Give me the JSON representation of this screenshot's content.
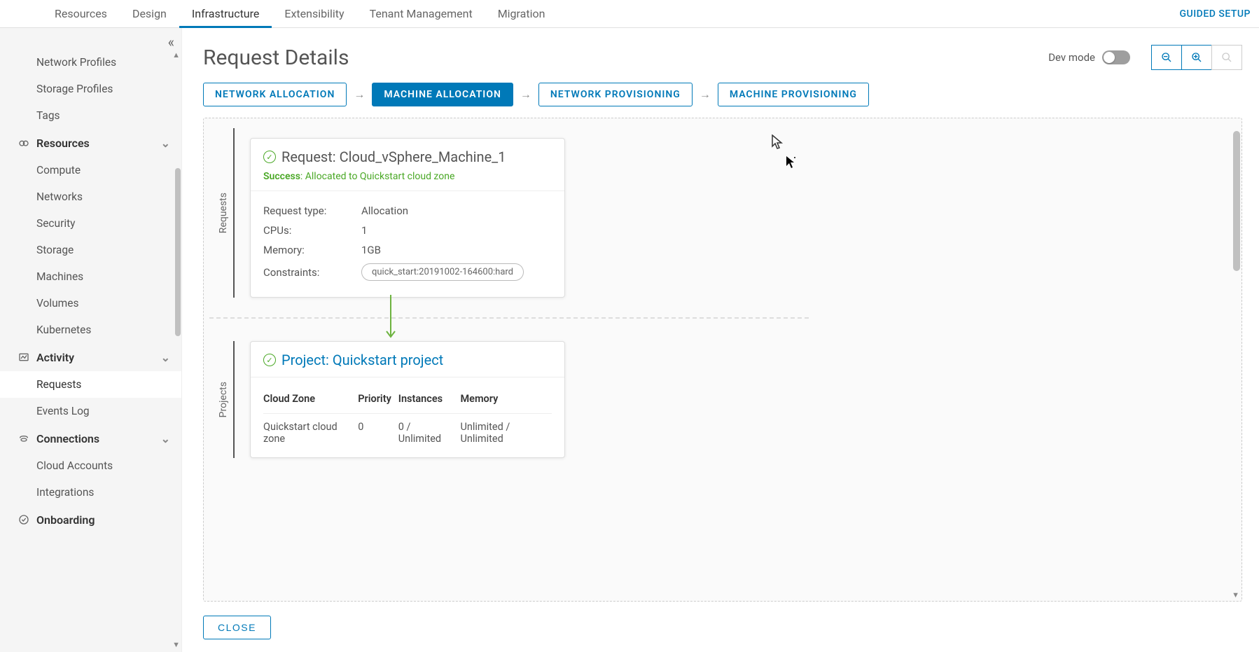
{
  "topNav": {
    "tabs": [
      "Resources",
      "Design",
      "Infrastructure",
      "Extensibility",
      "Tenant Management",
      "Migration"
    ],
    "active": "Infrastructure",
    "guided": "GUIDED SETUP"
  },
  "sidebar": {
    "itemsTop": [
      "Network Profiles",
      "Storage Profiles",
      "Tags"
    ],
    "groups": [
      {
        "label": "Resources",
        "icon": "resources-icon",
        "items": [
          "Compute",
          "Networks",
          "Security",
          "Storage",
          "Machines",
          "Volumes",
          "Kubernetes"
        ]
      },
      {
        "label": "Activity",
        "icon": "activity-icon",
        "items": [
          "Requests",
          "Events Log"
        ],
        "active": "Requests"
      },
      {
        "label": "Connections",
        "icon": "connections-icon",
        "items": [
          "Cloud Accounts",
          "Integrations"
        ]
      },
      {
        "label": "Onboarding",
        "icon": "onboarding-icon",
        "items": []
      }
    ]
  },
  "main": {
    "title": "Request Details",
    "devMode": "Dev mode",
    "chips": [
      "NETWORK ALLOCATION",
      "MACHINE ALLOCATION",
      "NETWORK PROVISIONING",
      "MACHINE PROVISIONING"
    ],
    "activeChip": "MACHINE ALLOCATION",
    "closeLabel": "CLOSE"
  },
  "flow": {
    "requestsLabel": "Requests",
    "projectsLabel": "Projects",
    "requestCard": {
      "title": "Request: Cloud_vSphere_Machine_1",
      "statusLabel": "Success",
      "statusText": ": Allocated to Quickstart cloud zone",
      "rows": {
        "requestTypeLabel": "Request type:",
        "requestTypeValue": "Allocation",
        "cpusLabel": "CPUs:",
        "cpusValue": "1",
        "memoryLabel": "Memory:",
        "memoryValue": "1GB",
        "constraintsLabel": "Constraints:",
        "constraintsValue": "quick_start:20191002-164600:hard"
      }
    },
    "projectCard": {
      "title": "Project: Quickstart project",
      "columns": [
        "Cloud Zone",
        "Priority",
        "Instances",
        "Memory"
      ],
      "row": {
        "zone": "Quickstart cloud zone",
        "priority": "0",
        "instances": "0 / Unlimited",
        "memory": "Unlimited / Unlimited"
      }
    }
  }
}
